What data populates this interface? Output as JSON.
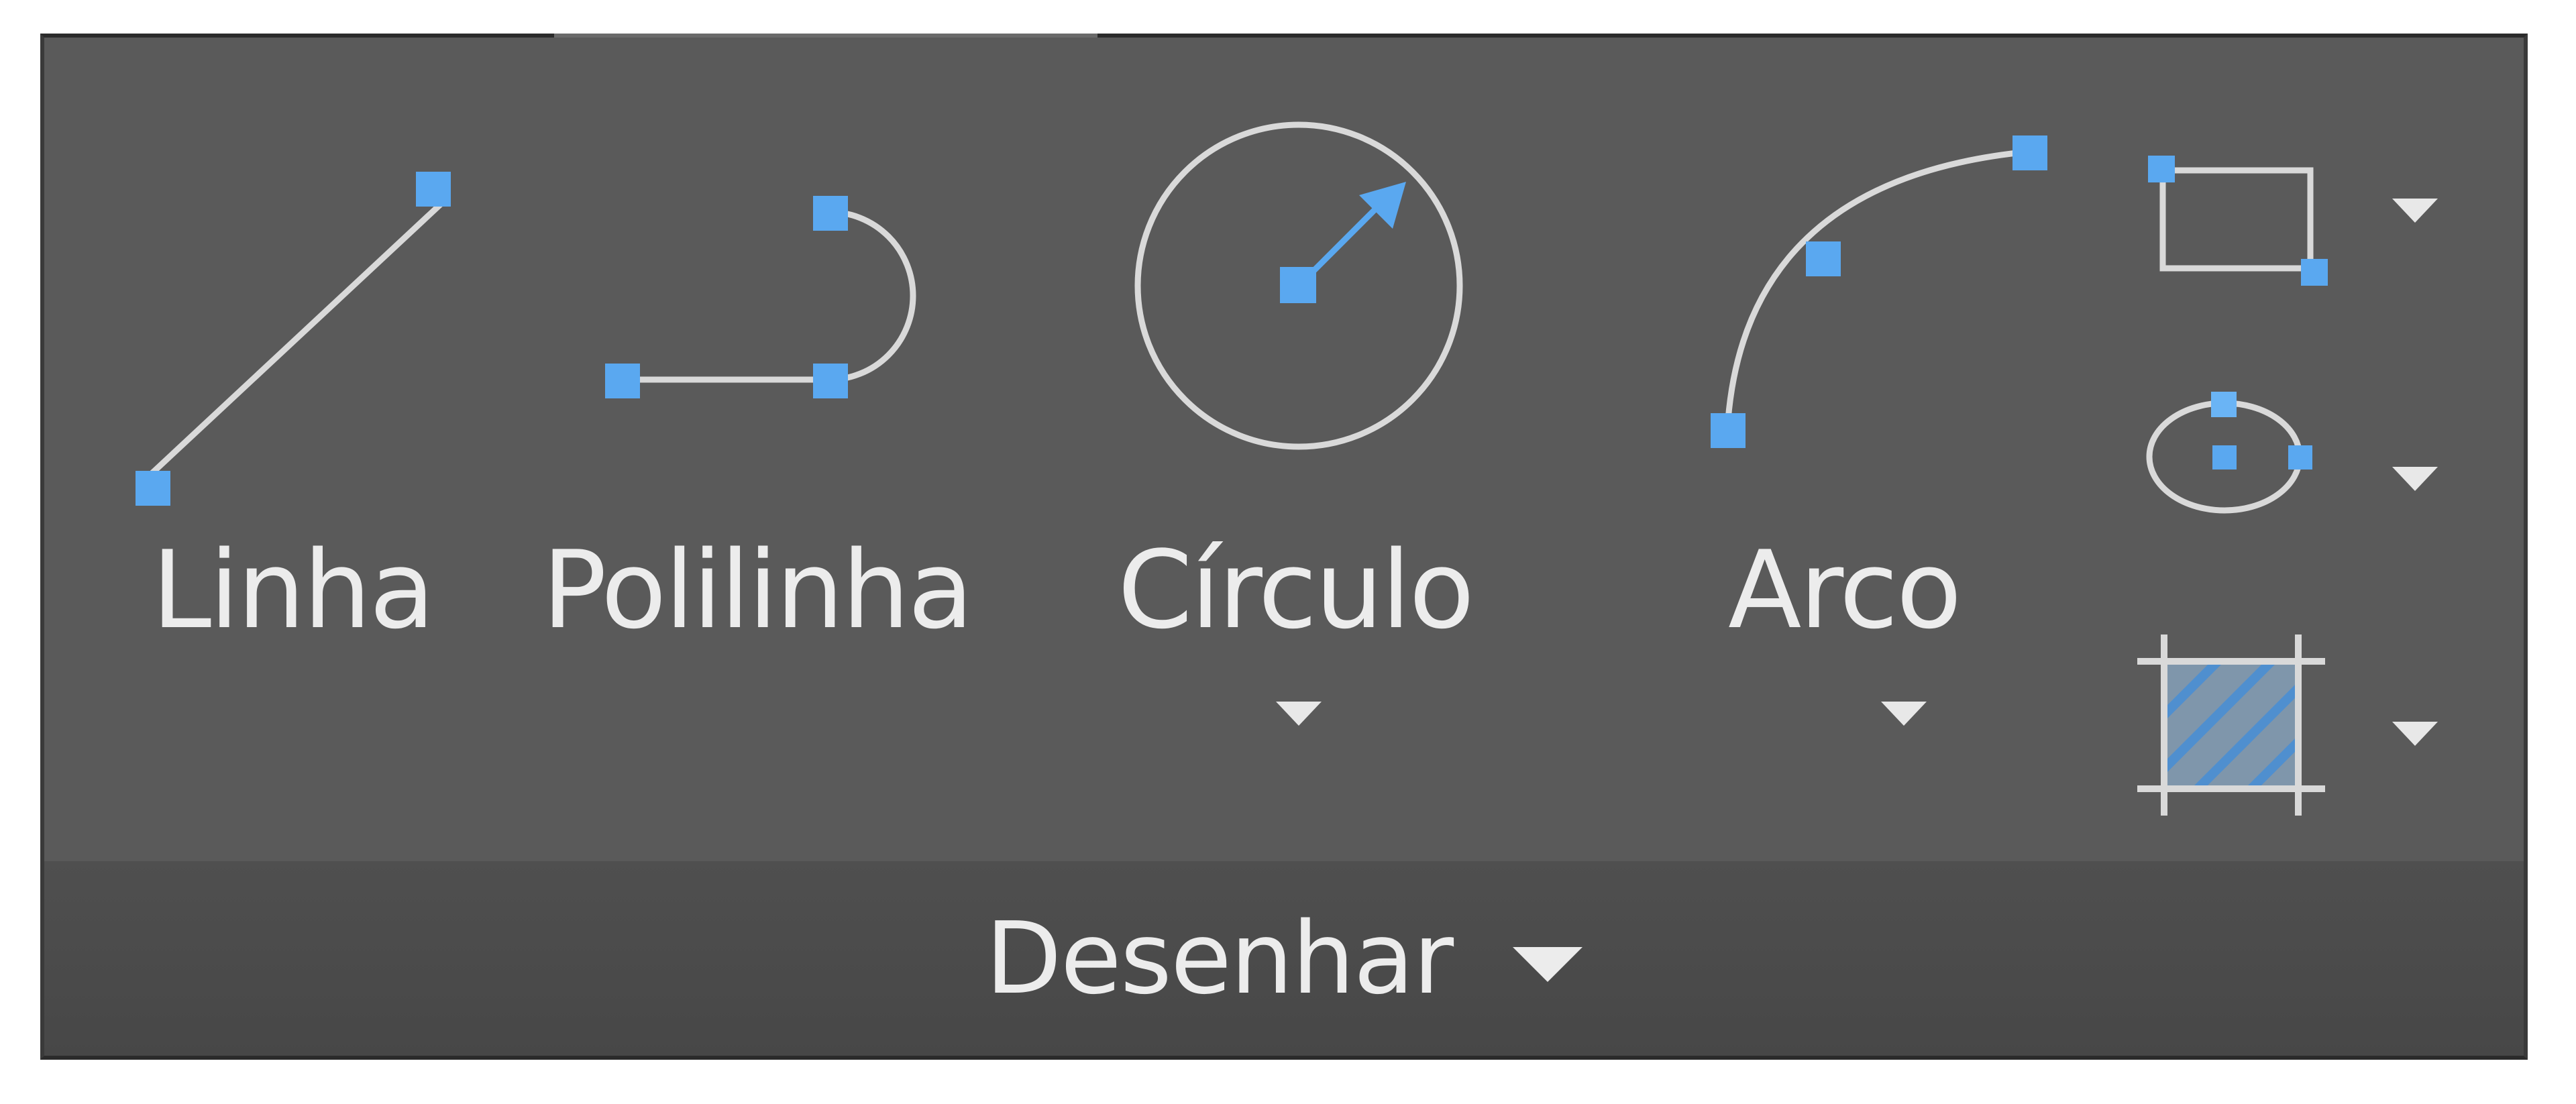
{
  "panel": {
    "title": "Desenhar",
    "accent_grip_color": "#5aa8f0",
    "background_color": "#5a5a5a",
    "footer_color": "#4b4b4b"
  },
  "tools": {
    "line": {
      "label": "Linha",
      "icon": "line-icon"
    },
    "polyline": {
      "label": "Polilinha",
      "icon": "polyline-icon"
    },
    "circle": {
      "label": "Círculo",
      "icon": "circle-icon"
    },
    "arc": {
      "label": "Arco",
      "icon": "arc-icon"
    }
  },
  "small_tools": [
    {
      "icon": "rectangle-icon"
    },
    {
      "icon": "ellipse-icon"
    },
    {
      "icon": "hatch-icon"
    }
  ]
}
